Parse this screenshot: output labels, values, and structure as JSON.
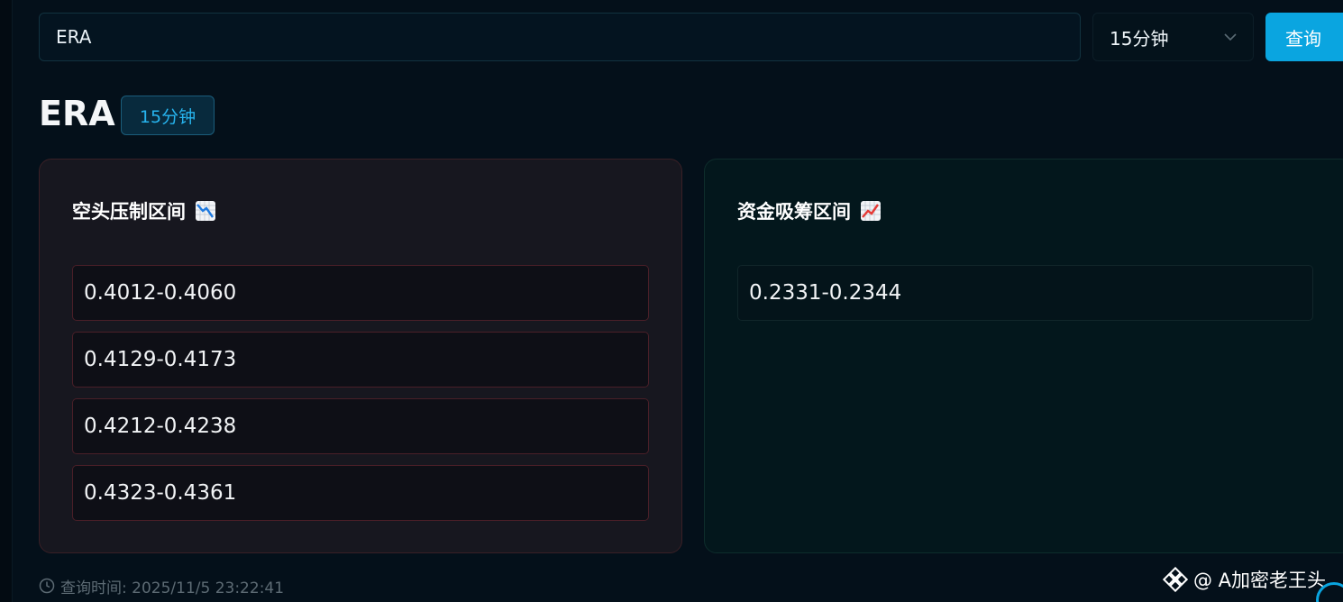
{
  "search": {
    "value": "ERA",
    "placeholder": ""
  },
  "interval_select": {
    "selected": "15分钟"
  },
  "query_button": {
    "label": "查询"
  },
  "header": {
    "symbol": "ERA",
    "interval_badge": "15分钟"
  },
  "bearish_card": {
    "title": "空头压制区间",
    "icon": "chart-decreasing-icon",
    "ranges": [
      "0.4012-0.4060",
      "0.4129-0.4173",
      "0.4212-0.4238",
      "0.4323-0.4361"
    ]
  },
  "bullish_card": {
    "title": "资金吸筹区间",
    "icon": "chart-increasing-icon",
    "ranges": [
      "0.2331-0.2344"
    ]
  },
  "footer": {
    "query_time": "查询时间: 2025/11/5 23:22:41"
  },
  "watermark": {
    "text": "@ A加密老王头",
    "icon": "binance-logo-icon"
  },
  "colors": {
    "accent": "#0aa5e0",
    "background": "#04101a",
    "bearish_border": "#4a1f28",
    "bullish_bg": "#03171c"
  }
}
